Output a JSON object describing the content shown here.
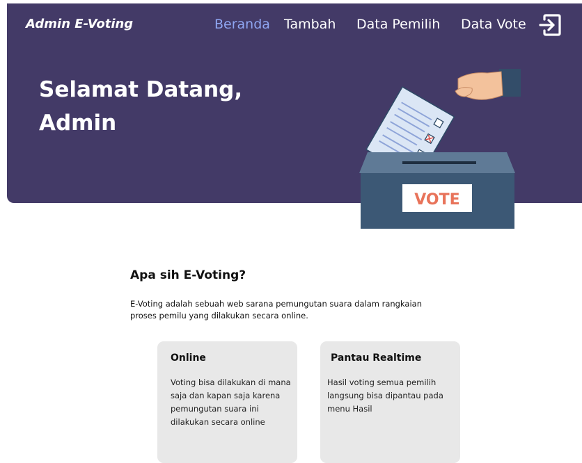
{
  "header": {
    "brand": "Admin E-Voting",
    "nav": [
      {
        "label": "Beranda",
        "active": true
      },
      {
        "label": "Tambah",
        "active": false
      },
      {
        "label": "Data Pemilih",
        "active": false
      },
      {
        "label": "Data Vote",
        "active": false
      }
    ],
    "logout_icon": "logout-icon"
  },
  "hero": {
    "greeting_line1": "Selamat Datang,",
    "greeting_line2": "Admin",
    "ballot_box_label": "VOTE"
  },
  "about": {
    "title": "Apa sih E-Voting?",
    "description": "E-Voting adalah sebuah web sarana pemungutan suara dalam rangkaian  proses pemilu yang dilakukan secara online."
  },
  "cards": [
    {
      "title": "Online",
      "body": "Voting bisa dilakukan di mana saja dan kapan saja karena pemungutan suara ini dilakukan secara online"
    },
    {
      "title": "Pantau Realtime",
      "body": "Hasil voting semua pemilih langsung bisa dipantau pada menu Hasil"
    }
  ],
  "colors": {
    "hero_bg": "#433a67",
    "nav_active": "#8fa6f2",
    "card_bg": "#e8e8e8",
    "vote_text": "#e8735a",
    "box_body": "#3c5875"
  }
}
